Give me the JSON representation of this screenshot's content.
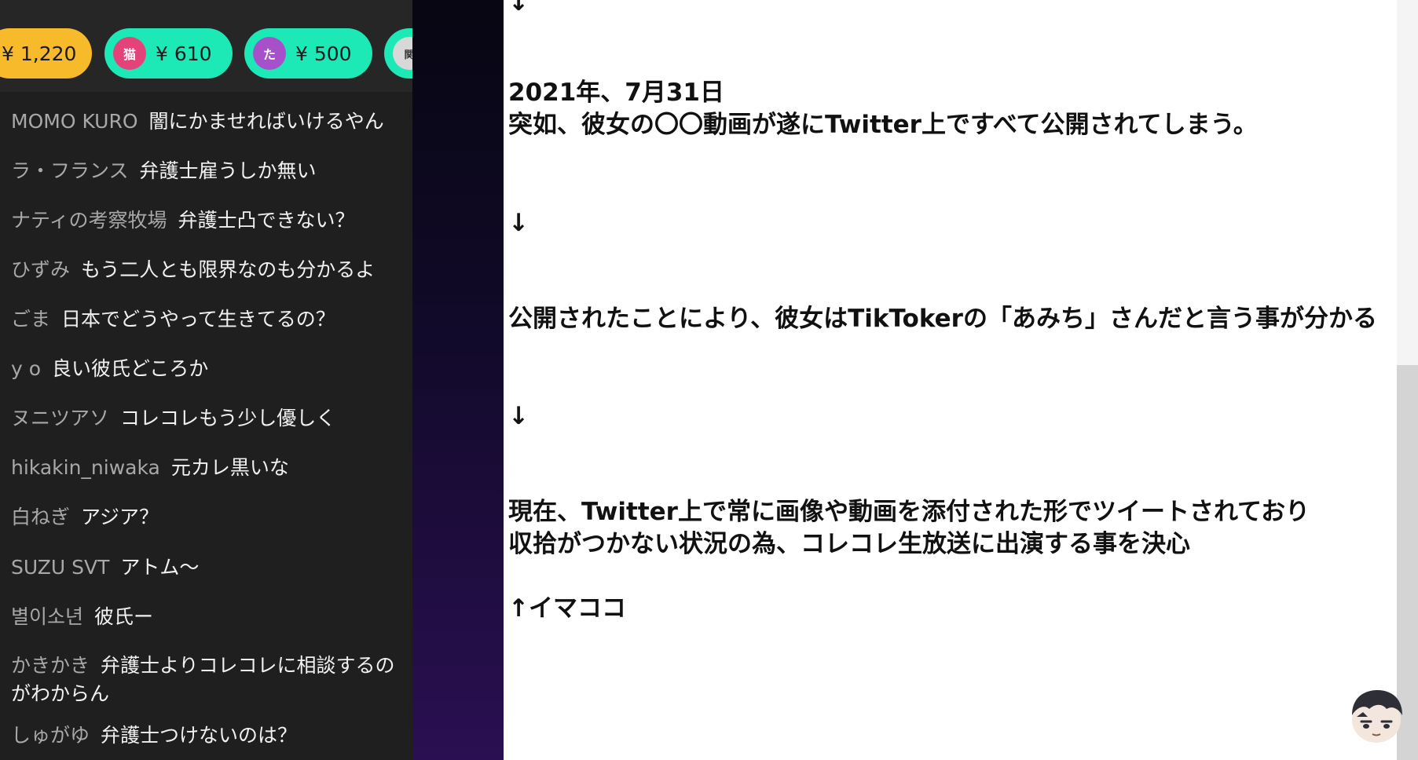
{
  "chat": {
    "chips": [
      {
        "amount": "¥ 1,220"
      },
      {
        "avatar": "猫",
        "amount": "¥ 610"
      },
      {
        "avatar": "た",
        "amount": "¥ 500"
      },
      {
        "avatar": "関"
      }
    ],
    "messages": [
      {
        "author": "MOMO KURO",
        "text": "闇にかませればいけるやん"
      },
      {
        "author": "ラ・フランス",
        "text": "弁護士雇うしか無い"
      },
      {
        "author": "ナティの考察牧場",
        "text": "弁護士凸できない？"
      },
      {
        "author": "ひずみ",
        "text": "もう二人とも限界なのも分かるよ"
      },
      {
        "author": "ごま",
        "text": "日本でどうやって生きてるの？"
      },
      {
        "author": "y o",
        "text": "良い彼氏どころか"
      },
      {
        "author": "ヌニツアソ",
        "text": "コレコレもう少し優しく"
      },
      {
        "author": "hikakin_niwaka",
        "text": "元カレ黒いな"
      },
      {
        "author": "白ねぎ",
        "text": "アジア？"
      },
      {
        "author": "SUZU SVT",
        "text": "アトム～"
      },
      {
        "author": "별이소년",
        "text": "彼氏ー"
      },
      {
        "author": "かきかき",
        "text": "弁護士よりコレコレに相談するのがわからん"
      },
      {
        "author": "しゅがゆ",
        "text": "弁護士つけないのは？"
      }
    ]
  },
  "document": {
    "lines": [
      "↓",
      "2021年、7月31日",
      "突如、彼女の〇〇動画が遂にTwitter上ですべて公開されてしまう。",
      "↓",
      "公開されたことにより、彼女はTikTokerの「あみち」さんだと言う事が分かる",
      "↓",
      "現在、Twitter上で常に画像や動画を添付された形でツイートされており",
      "収拾がつかない状況の為、コレコレ生放送に出演する事を決心",
      "↑イマココ"
    ]
  },
  "colors": {
    "gold_chip": "#f6ba2a",
    "teal_chip": "#1de9b6",
    "chat_bg": "#1f1f1f",
    "doc_bg": "#ffffff"
  }
}
